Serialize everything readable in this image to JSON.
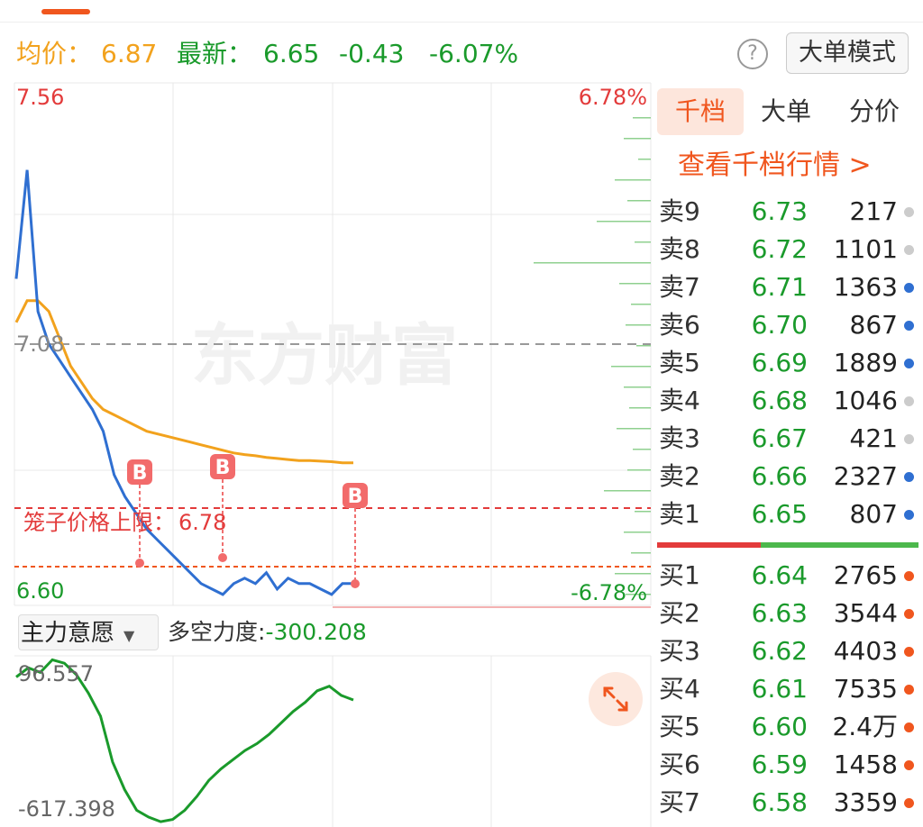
{
  "header": {
    "avg_label": "均价：",
    "avg_value": "6.87",
    "last_label": "最新：",
    "last_value": "6.65",
    "change": "-0.43",
    "change_pct": "-6.07%",
    "help_icon": "?",
    "mode_button": "大单模式"
  },
  "chart": {
    "y_high": "7.56",
    "y_mid": "7.08",
    "y_low": "6.60",
    "pct_high": "6.78%",
    "pct_low": "-6.78%",
    "watermark": "东方财富",
    "cage_label": "笼子价格上限：",
    "cage_value": "6.78",
    "b_marker": "B"
  },
  "chart_data": [
    {
      "type": "line",
      "title": "",
      "ylim": [
        6.6,
        7.56
      ],
      "series": [
        {
          "values": [
            7.2,
            7.4,
            7.14,
            7.08,
            7.05,
            7.02,
            6.99,
            6.96,
            6.92,
            6.84,
            6.8,
            6.77,
            6.74,
            6.72,
            6.7,
            6.68,
            6.66,
            6.64,
            6.63,
            6.62,
            6.64,
            6.65,
            6.64,
            6.66,
            6.63,
            6.65,
            6.64,
            6.64,
            6.63,
            6.62,
            6.64,
            6.64
          ]
        },
        {
          "values": [
            7.12,
            7.16,
            7.16,
            7.14,
            7.09,
            7.04,
            7.01,
            6.98,
            6.96,
            6.95,
            6.94,
            6.93,
            6.92,
            6.915,
            6.91,
            6.905,
            6.9,
            6.895,
            6.89,
            6.885,
            6.88,
            6.877,
            6.875,
            6.872,
            6.87,
            6.868,
            6.866,
            6.866,
            6.865,
            6.864,
            6.862,
            6.862
          ]
        }
      ]
    },
    {
      "type": "line",
      "y_top_label": "96.557",
      "y_bottom_label": "-617.398",
      "ylim": [
        -617.398,
        96.557
      ],
      "series": [
        {
          "values": [
            20,
            60,
            40,
            95,
            80,
            30,
            -50,
            -150,
            -350,
            -470,
            -560,
            -590,
            -610,
            -600,
            -560,
            -500,
            -430,
            -380,
            -340,
            -300,
            -270,
            -230,
            -180,
            -130,
            -90,
            -40,
            -20,
            -60,
            -80
          ]
        }
      ]
    }
  ],
  "indicator": {
    "name": "主力意愿",
    "caret": "▼",
    "dk_label": "多空力度:",
    "dk_value": "-300.208"
  },
  "panel": {
    "tabs": [
      "千档",
      "大单",
      "分价"
    ],
    "view_link": "查看千档行情 >",
    "asks": [
      {
        "label": "卖9",
        "price": "6.73",
        "vol": "217",
        "dot": "#cccccc"
      },
      {
        "label": "卖8",
        "price": "6.72",
        "vol": "1101",
        "dot": "#cccccc"
      },
      {
        "label": "卖7",
        "price": "6.71",
        "vol": "1363",
        "dot": "#2f6fd1"
      },
      {
        "label": "卖6",
        "price": "6.70",
        "vol": "867",
        "dot": "#2f6fd1"
      },
      {
        "label": "卖5",
        "price": "6.69",
        "vol": "1889",
        "dot": "#2f6fd1"
      },
      {
        "label": "卖4",
        "price": "6.68",
        "vol": "1046",
        "dot": "#cccccc"
      },
      {
        "label": "卖3",
        "price": "6.67",
        "vol": "421",
        "dot": "#cccccc"
      },
      {
        "label": "卖2",
        "price": "6.66",
        "vol": "2327",
        "dot": "#2f6fd1"
      },
      {
        "label": "卖1",
        "price": "6.65",
        "vol": "807",
        "dot": "#2f6fd1"
      }
    ],
    "bids": [
      {
        "label": "买1",
        "price": "6.64",
        "vol": "2765",
        "dot": "#f0561e"
      },
      {
        "label": "买2",
        "price": "6.63",
        "vol": "3544",
        "dot": "#f0561e"
      },
      {
        "label": "买3",
        "price": "6.62",
        "vol": "4403",
        "dot": "#f0561e"
      },
      {
        "label": "买4",
        "price": "6.61",
        "vol": "7535",
        "dot": "#f0561e"
      },
      {
        "label": "买5",
        "price": "6.60",
        "vol": "2.4万",
        "dot": "#f0561e"
      },
      {
        "label": "买6",
        "price": "6.59",
        "vol": "1458",
        "dot": "#f0561e"
      },
      {
        "label": "买7",
        "price": "6.58",
        "vol": "3359",
        "dot": "#f0561e"
      }
    ]
  },
  "colors": {
    "accent": "#f0561e",
    "up": "#e33b3b",
    "down": "#1a9a2b",
    "avg_line": "#f2a21d",
    "price_line": "#2f6fd1"
  }
}
